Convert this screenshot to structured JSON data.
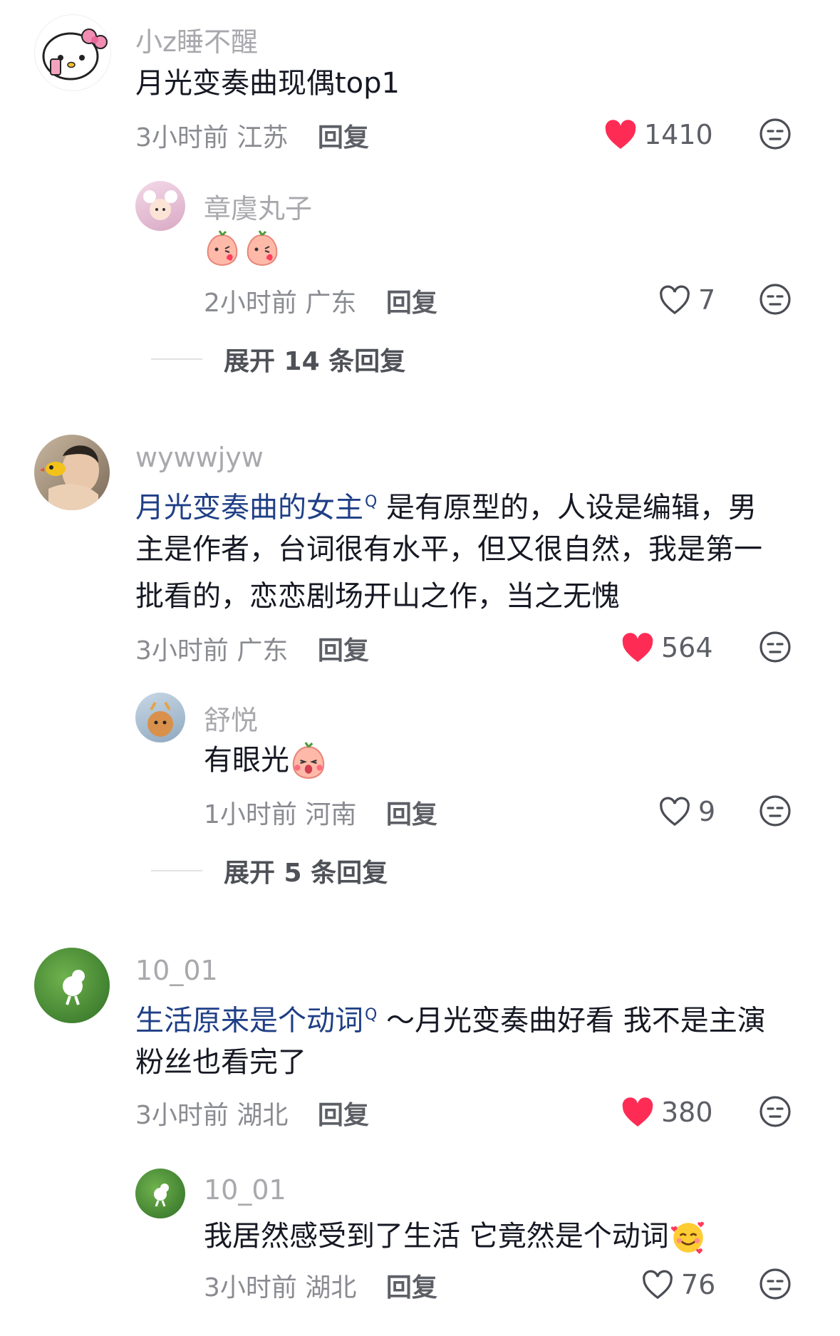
{
  "comments": [
    {
      "username": "小z睡不醒",
      "text": "月光变奏曲现偶top1",
      "time": "3小时前",
      "location": "江苏",
      "reply_label": "回复",
      "likes": "1410",
      "liked": true,
      "replies": [
        {
          "username": "章虞丸子",
          "text": "",
          "time": "2小时前",
          "location": "广东",
          "reply_label": "回复",
          "likes": "7",
          "liked": false
        }
      ],
      "expand_label": "展开 14 条回复"
    },
    {
      "username": "wywwjyw",
      "text_link": "月光变奏曲的女主",
      "text_line1": "是有原型的，人设是编辑，男",
      "text_line2": "主是作者，台词很有水平，但又很自然，我是第一",
      "text_line3": "批看的，恋恋剧场开山之作，当之无愧",
      "time": "3小时前",
      "location": "广东",
      "reply_label": "回复",
      "likes": "564",
      "liked": true,
      "replies": [
        {
          "username": "舒悦",
          "text": "有眼光",
          "time": "1小时前",
          "location": "河南",
          "reply_label": "回复",
          "likes": "9",
          "liked": false
        }
      ],
      "expand_label": "展开 5 条回复"
    },
    {
      "username": "10_01",
      "text_link": "生活原来是个动词",
      "text_line1": "～月光变奏曲好看 我不是主演",
      "text_line2": "粉丝也看完了",
      "time": "3小时前",
      "location": "湖北",
      "reply_label": "回复",
      "likes": "380",
      "liked": true,
      "replies": [
        {
          "username": "10_01",
          "text": "我居然感受到了生活 它竟然是个动词",
          "time": "3小时前",
          "location": "湖北",
          "reply_label": "回复",
          "likes": "76",
          "liked": false
        }
      ]
    }
  ],
  "colors": {
    "like_red": "#fe2c55",
    "link_blue": "#1f3f86",
    "meta_gray": "#8a8b91"
  },
  "icons": [
    "heart-filled-icon",
    "heart-outline-icon",
    "dislike-face-icon",
    "search-suffix-icon"
  ]
}
